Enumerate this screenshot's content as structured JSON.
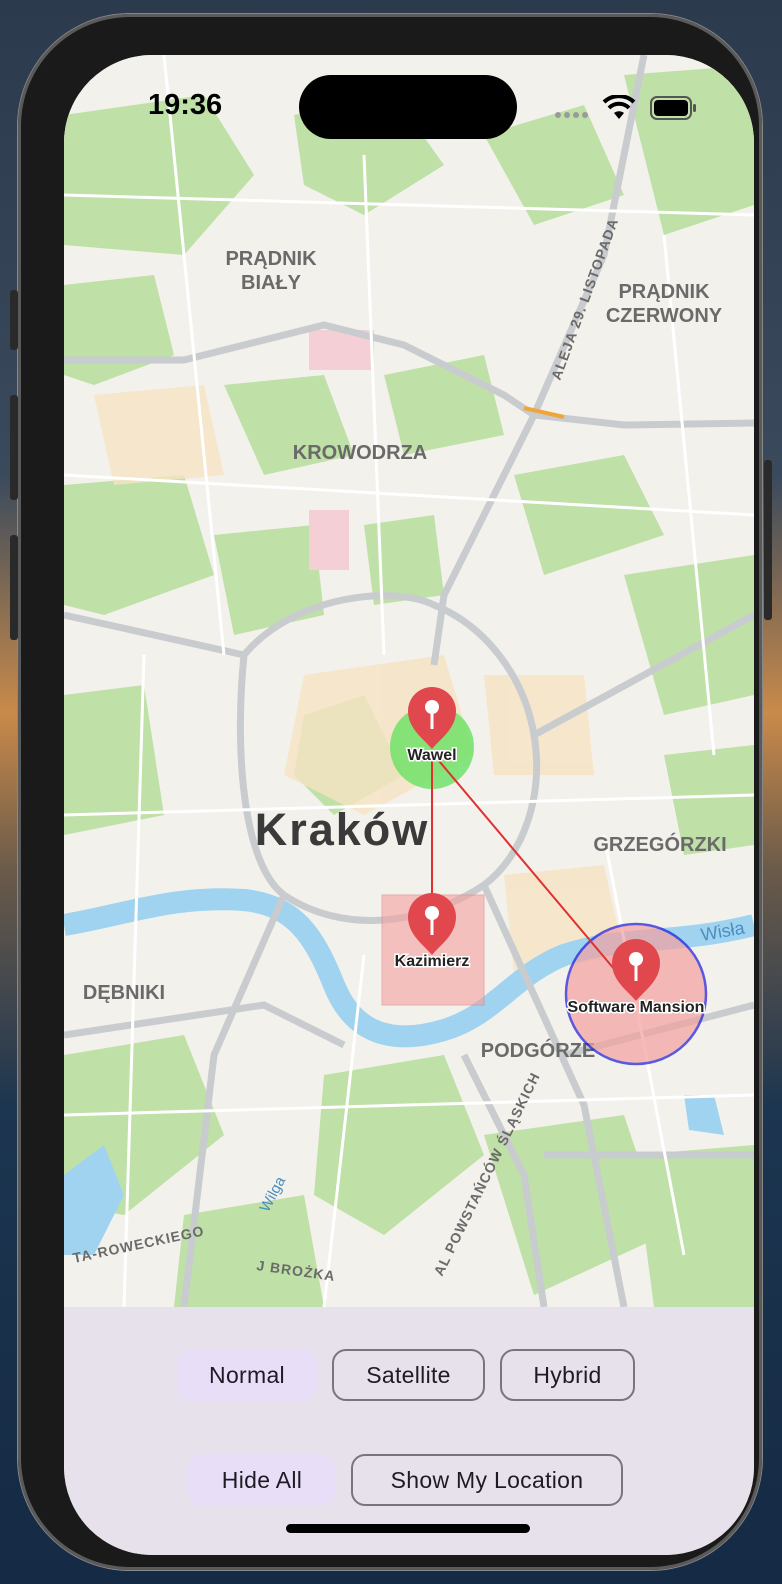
{
  "status_bar": {
    "time": "19:36"
  },
  "map": {
    "city_label": "Kraków",
    "district_labels": [
      "PRĄDNIK",
      "BIAŁY",
      "PRĄDNIK",
      "CZERWONY",
      "KROWODRZA",
      "GRZEGÓRZKI",
      "DĘBNIKI",
      "PODGÓRZE"
    ],
    "street_labels": [
      "ALEJA 29. LISTOPADA",
      "AL POWSTAŃCÓW ŚLĄSKICH",
      "TA-ROWECKIEGO",
      "J BROŻKA",
      "Wilga",
      "Wisła"
    ],
    "markers": [
      {
        "label": "Wawel"
      },
      {
        "label": "Kazimierz"
      },
      {
        "label": "Software Mansion"
      }
    ],
    "colors": {
      "marker": "#e0484d",
      "wawel_circle": "#5fe05a",
      "polygon_fill": "#f3a0a0",
      "circle_stroke": "#1a1ad8",
      "polyline": "#e03030",
      "river": "#9fd3ef",
      "park": "#b8dc9c"
    }
  },
  "controls": {
    "map_type_buttons": [
      "Normal",
      "Satellite",
      "Hybrid"
    ],
    "selected_map_type": "Normal",
    "hide_all_label": "Hide All",
    "show_location_label": "Show My Location"
  }
}
